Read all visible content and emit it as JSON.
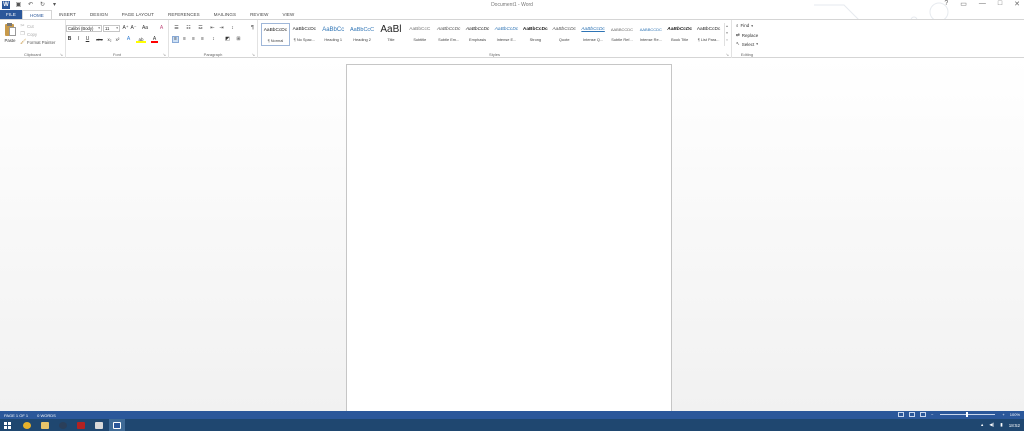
{
  "window": {
    "title": "Document1 - Word",
    "controls": [
      "?",
      "▭",
      "—",
      "□",
      "✕"
    ]
  },
  "qat": {
    "icons": [
      "word-app-icon",
      "save-icon",
      "undo-icon",
      "redo-icon",
      "customize-icon"
    ]
  },
  "tabs": [
    {
      "label": "FILE"
    },
    {
      "label": "HOME"
    },
    {
      "label": "INSERT"
    },
    {
      "label": "DESIGN"
    },
    {
      "label": "PAGE LAYOUT"
    },
    {
      "label": "REFERENCES"
    },
    {
      "label": "MAILINGS"
    },
    {
      "label": "REVIEW"
    },
    {
      "label": "VIEW"
    }
  ],
  "clipboard": {
    "paste": "Paste",
    "cut": "Cut",
    "copy": "Copy",
    "format_painter": "Format Painter",
    "label": "Clipboard"
  },
  "font": {
    "name": "Calibri (Body)",
    "size": "11",
    "grow": "A⁺",
    "shrink": "A⁻",
    "case": "Aa",
    "clear": "A",
    "bold": "B",
    "italic": "I",
    "underline": "U",
    "strike": "abc",
    "subscript": "x₂",
    "superscript": "x²",
    "effects": "A",
    "highlight": "ab",
    "color": "A",
    "label": "Font"
  },
  "paragraph": {
    "label": "Paragraph",
    "pilcrow": "¶"
  },
  "styles": {
    "label": "Styles",
    "items": [
      {
        "preview": "AaBbCcDc",
        "name": "¶ Normal",
        "selected": true
      },
      {
        "preview": "AaBbCcDc",
        "name": "¶ No Spac..."
      },
      {
        "preview": "AaBbCc",
        "name": "Heading 1"
      },
      {
        "preview": "AaBbCcC",
        "name": "Heading 2"
      },
      {
        "preview": "AaBl",
        "name": "Title"
      },
      {
        "preview": "AaBbCcC",
        "name": "Subtitle"
      },
      {
        "preview": "AaBbCcDc",
        "name": "Subtle Em..."
      },
      {
        "preview": "AaBbCcDc",
        "name": "Emphasis"
      },
      {
        "preview": "AaBbCcDc",
        "name": "Intense E..."
      },
      {
        "preview": "AaBbCcDc",
        "name": "Strong"
      },
      {
        "preview": "AaBbCcDc",
        "name": "Quote"
      },
      {
        "preview": "AaBbCcDc",
        "name": "Intense Q..."
      },
      {
        "preview": "AABBCCDC",
        "name": "Subtle Ref..."
      },
      {
        "preview": "AABBCCDC",
        "name": "Intense Re..."
      },
      {
        "preview": "AaBbCcDc",
        "name": "Book Title"
      },
      {
        "preview": "AaBbCcDc",
        "name": "¶ List Para..."
      }
    ]
  },
  "editing": {
    "find": "Find",
    "replace": "Replace",
    "select": "Select",
    "label": "Editing"
  },
  "status": {
    "page": "PAGE 1 OF 1",
    "words": "0 WORDS",
    "zoom": "100%"
  },
  "taskbar": {
    "time": "18:52"
  },
  "colors": {
    "accent": "#2b579a",
    "taskbar": "#1f4770",
    "highlight": "#ffff00",
    "font_color": "#ff0000"
  }
}
